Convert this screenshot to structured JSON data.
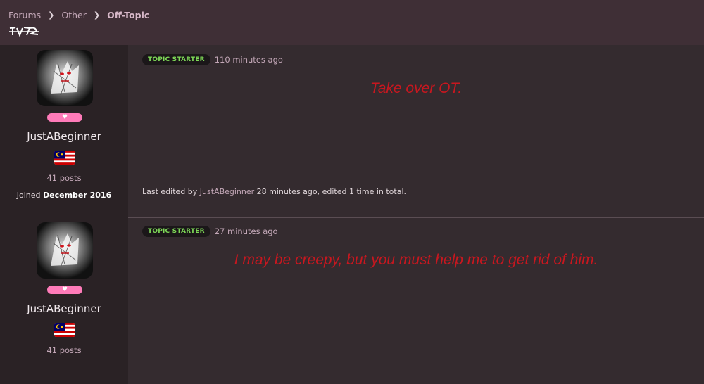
{
  "breadcrumb": {
    "items": [
      "Forums",
      "Other",
      "Off-Topic"
    ]
  },
  "posts": [
    {
      "badge_label": "TOPIC STARTER",
      "time": "110 minutes ago",
      "content": "Take over OT.",
      "edited_prefix": "Last edited by",
      "edited_user": "JustABeginner",
      "edited_suffix": "28 minutes ago, edited 1 time in total.",
      "author": {
        "username": "JustABeginner",
        "posts": "41 posts",
        "joined_prefix": "Joined",
        "joined_date": "December 2016"
      }
    },
    {
      "badge_label": "TOPIC STARTER",
      "time": "27 minutes ago",
      "content": "I may be creepy, but you must help me to get rid of him.",
      "author": {
        "username": "JustABeginner",
        "posts": "41 posts"
      }
    }
  ],
  "colors": {
    "accent_pink": "#ff7bb9",
    "content_red": "#c8171f",
    "badge_green": "#7ed957"
  },
  "icons": {
    "separator": "chevron-right-icon",
    "heart": "heart-icon",
    "flag": "malaysia-flag-icon"
  }
}
